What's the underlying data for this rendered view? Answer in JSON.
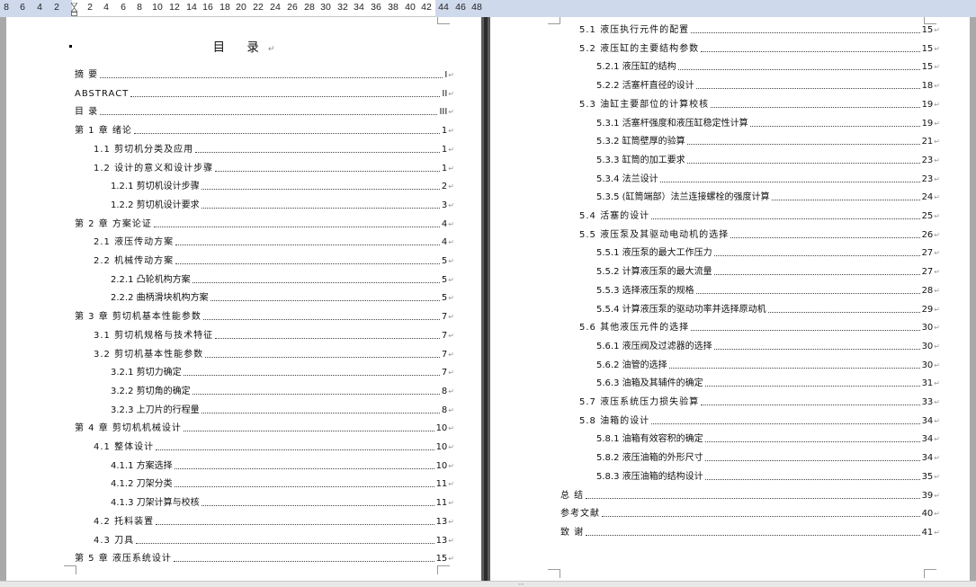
{
  "ruler": {
    "ticks": [
      "8",
      "6",
      "4",
      "2",
      "2",
      "4",
      "6",
      "8",
      "10",
      "12",
      "14",
      "16",
      "18",
      "20",
      "22",
      "24",
      "26",
      "28",
      "30",
      "32",
      "34",
      "36",
      "38",
      "40",
      "42",
      "44",
      "46",
      "48"
    ]
  },
  "left_page": {
    "title": "目 录",
    "title_mark": "↵",
    "entries": [
      {
        "label": "摘    要",
        "page": "I"
      },
      {
        "label": "ABSTRACT",
        "page": "II"
      },
      {
        "label": "目    录",
        "page": "III"
      },
      {
        "label": "第 1 章    绪论",
        "page": "1"
      },
      {
        "label": "1.1 剪切机分类及应用",
        "page": "1"
      },
      {
        "label": "1.2 设计的意义和设计步骤",
        "page": "1"
      },
      {
        "label": "1.2.1 剪切机设计步骤",
        "page": "2"
      },
      {
        "label": "1.2.2 剪切机设计要求",
        "page": "3"
      },
      {
        "label": "第 2 章    方案论证",
        "page": "4"
      },
      {
        "label": "2.1 液压传动方案",
        "page": "4"
      },
      {
        "label": "2.2 机械传动方案",
        "page": "5"
      },
      {
        "label": "2.2.1 凸轮机构方案",
        "page": "5"
      },
      {
        "label": "2.2.2 曲柄滑块机构方案",
        "page": "5"
      },
      {
        "label": "第 3 章   剪切机基本性能参数",
        "page": "7"
      },
      {
        "label": "3.1 剪切机规格与技术特征",
        "page": "7"
      },
      {
        "label": "3.2 剪切机基本性能参数",
        "page": "7"
      },
      {
        "label": "3.2.1 剪切力确定",
        "page": "7"
      },
      {
        "label": "3.2.2 剪切角的确定",
        "page": "8"
      },
      {
        "label": "3.2.3 上刀片的行程量",
        "page": "8"
      },
      {
        "label": "第 4 章   剪切机机械设计",
        "page": "10"
      },
      {
        "label": "4.1 整体设计",
        "page": "10"
      },
      {
        "label": "4.1.1 方案选择",
        "page": "10"
      },
      {
        "label": "4.1.2 刀架分类",
        "page": "11"
      },
      {
        "label": "4.1.3 刀架计算与校核",
        "page": "11"
      },
      {
        "label": "4.2 托料装置",
        "page": "13"
      },
      {
        "label": "4.3 刀具",
        "page": "13"
      },
      {
        "label": "第 5 章   液压系统设计",
        "page": "15"
      }
    ]
  },
  "right_page": {
    "entries": [
      {
        "label": "5.1  液压执行元件的配置",
        "page": "15"
      },
      {
        "label": "5.2  液压缸的主要结构参数",
        "page": "15"
      },
      {
        "label": "5.2.1  液压缸的结构",
        "page": "15"
      },
      {
        "label": "5.2.2 活塞杆直径的设计",
        "page": "18"
      },
      {
        "label": "5.3  油缸主要部位的计算校核",
        "page": "19"
      },
      {
        "label": "5.3.1  活塞杆强度和液压缸稳定性计算",
        "page": "19"
      },
      {
        "label": "5.3.2 缸筒壁厚的验算",
        "page": "21"
      },
      {
        "label": "5.3.3  缸筒的加工要求",
        "page": "23"
      },
      {
        "label": "5.3.4 法兰设计",
        "page": "23"
      },
      {
        "label": "5.3.5 (缸筒端部）法兰连接螺栓的强度计算",
        "page": "24"
      },
      {
        "label": "5.4  活塞的设计",
        "page": "25"
      },
      {
        "label": "5.5  液压泵及其驱动电动机的选择",
        "page": "26"
      },
      {
        "label": "5.5.1 液压泵的最大工作压力",
        "page": "27"
      },
      {
        "label": "5.5.2 计算液压泵的最大流量",
        "page": "27"
      },
      {
        "label": "5.5.3 选择液压泵的规格",
        "page": "28"
      },
      {
        "label": "5.5.4 计算液压泵的驱动功率并选择原动机",
        "page": "29"
      },
      {
        "label": "5.6 其他液压元件的选择",
        "page": "30"
      },
      {
        "label": "5.6.1 液压阀及过滤器的选择",
        "page": "30"
      },
      {
        "label": "5.6.2 油管的选择",
        "page": "30"
      },
      {
        "label": "5.6.3 油箱及其辅件的确定",
        "page": "31"
      },
      {
        "label": "5.7 液压系统压力损失验算",
        "page": "33"
      },
      {
        "label": "5.8 油箱的设计",
        "page": "34"
      },
      {
        "label": "5.8.1 油箱有效容积的确定",
        "page": "34"
      },
      {
        "label": "5.8.2 液压油箱的外形尺寸",
        "page": "34"
      },
      {
        "label": "5.8.3 液压油箱的结构设计",
        "page": "35"
      },
      {
        "label": "总    结",
        "page": "39"
      },
      {
        "label": "参考文献",
        "page": "40"
      },
      {
        "label": "致    谢",
        "page": "41"
      }
    ]
  },
  "para_mark": "↵",
  "scroll_grip": "⋯"
}
